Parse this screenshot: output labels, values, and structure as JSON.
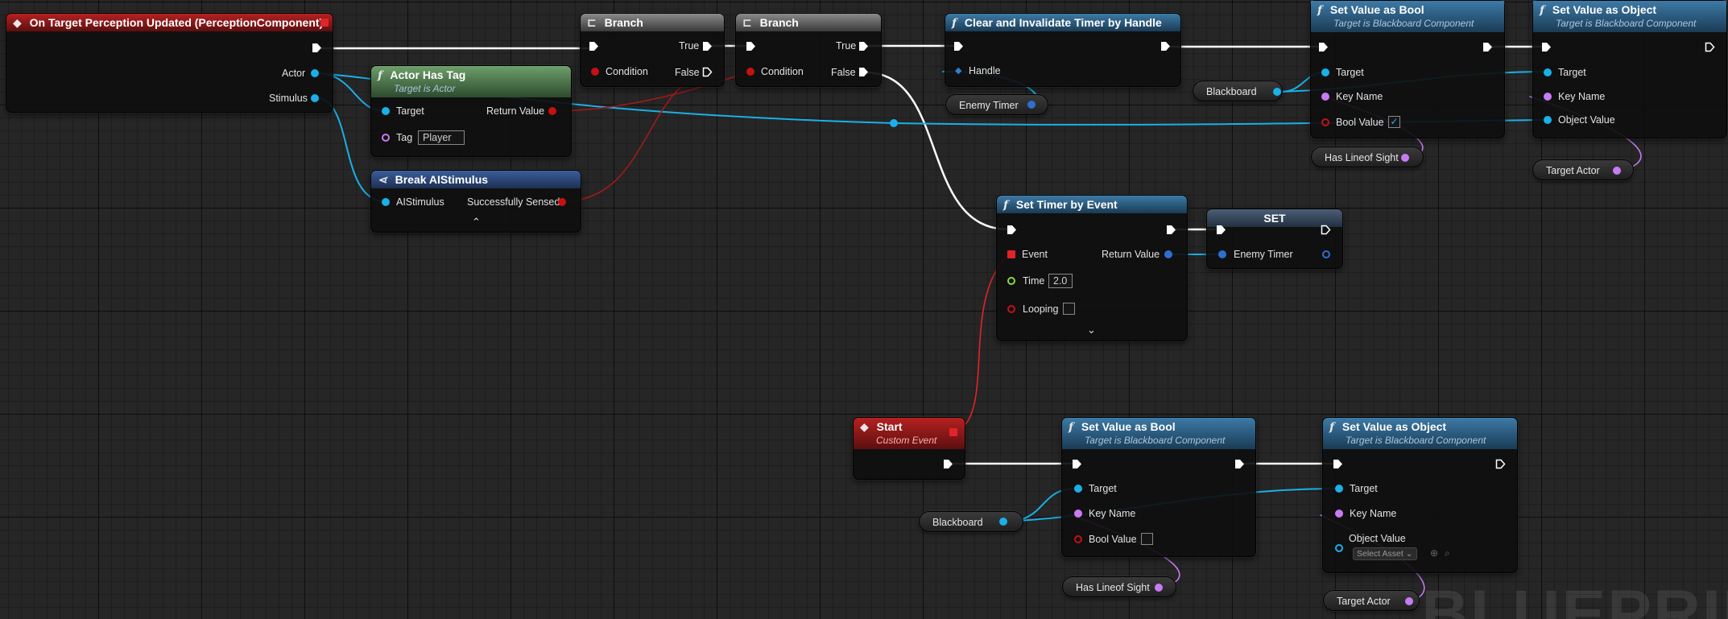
{
  "watermark": "BLUEPRINT",
  "nodes": {
    "on_target_perception": {
      "title": "On Target Perception Updated (PerceptionComponent)",
      "pins": {
        "actor": "Actor",
        "stimulus": "Stimulus"
      }
    },
    "actor_has_tag": {
      "title": "Actor Has Tag",
      "subtitle": "Target is Actor",
      "pins": {
        "target": "Target",
        "return_value": "Return Value",
        "tag": "Tag"
      },
      "tag_value": "Player"
    },
    "break_ai_stimulus": {
      "title": "Break AIStimulus",
      "pins": {
        "ai_stimulus": "AIStimulus",
        "successfully_sensed": "Successfully Sensed"
      }
    },
    "branch_1": {
      "title": "Branch",
      "pins": {
        "condition": "Condition",
        "true": "True",
        "false": "False"
      }
    },
    "branch_2": {
      "title": "Branch",
      "pins": {
        "condition": "Condition",
        "true": "True",
        "false": "False"
      }
    },
    "clear_invalidate_timer": {
      "title": "Clear and Invalidate Timer by Handle",
      "pins": {
        "handle": "Handle"
      }
    },
    "set_value_bool_top": {
      "title": "Set Value as Bool",
      "subtitle": "Target is Blackboard Component",
      "pins": {
        "target": "Target",
        "key_name": "Key Name",
        "bool_value": "Bool Value"
      },
      "bool_checked": true
    },
    "set_value_object_top": {
      "title": "Set Value as Object",
      "subtitle": "Target is Blackboard Component",
      "pins": {
        "target": "Target",
        "key_name": "Key Name",
        "object_value": "Object Value"
      }
    },
    "set_timer_by_event": {
      "title": "Set Timer by Event",
      "pins": {
        "event": "Event",
        "return_value": "Return Value",
        "time": "Time",
        "looping": "Looping"
      },
      "time_value": "2.0",
      "looping_checked": false
    },
    "set_enemy_timer": {
      "title": "SET",
      "pins": {
        "enemy_timer": "Enemy Timer"
      }
    },
    "start_event": {
      "title": "Start",
      "subtitle": "Custom Event"
    },
    "set_value_bool_bottom": {
      "title": "Set Value as Bool",
      "subtitle": "Target is Blackboard Component",
      "pins": {
        "target": "Target",
        "key_name": "Key Name",
        "bool_value": "Bool Value"
      },
      "bool_checked": false
    },
    "set_value_object_bottom": {
      "title": "Set Value as Object",
      "subtitle": "Target is Blackboard Component",
      "pins": {
        "target": "Target",
        "key_name": "Key Name",
        "object_value": "Object Value"
      },
      "select_asset": "Select Asset"
    }
  },
  "variables": {
    "enemy_timer": "Enemy Timer",
    "blackboard_top": "Blackboard",
    "has_lineof_sight_top": "Has Lineof Sight",
    "target_actor_top": "Target Actor",
    "blackboard_bottom": "Blackboard",
    "has_lineof_sight_bottom": "Has Lineof Sight",
    "target_actor_bottom": "Target Actor"
  },
  "colors": {
    "exec_wire": "#ffffff",
    "object_wire": "#1ab0e8",
    "bool_wire": "#a11a1a",
    "name_wire": "#c77bf2",
    "delegate_wire": "#e0242a"
  }
}
